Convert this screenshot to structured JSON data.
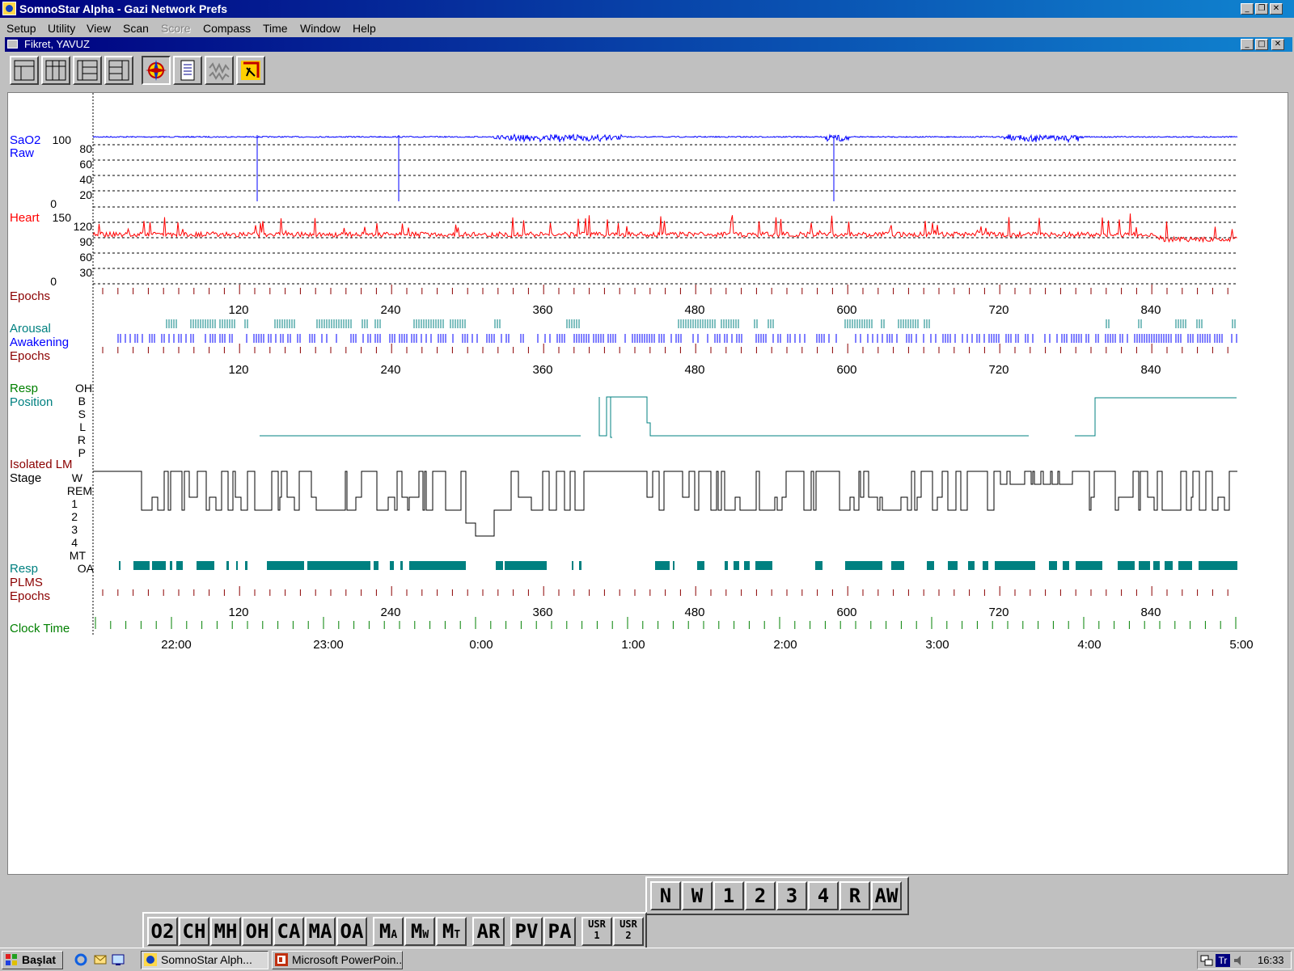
{
  "window": {
    "title": "SomnoStar Alpha - Gazi Network Prefs"
  },
  "menu": [
    "Setup",
    "Utility",
    "View",
    "Scan",
    "Score",
    "Compass",
    "Time",
    "Window",
    "Help"
  ],
  "child_window": {
    "title": "Fikret, YAVUZ"
  },
  "channels": {
    "sao2": {
      "label1": "SaO2",
      "label2": "Raw",
      "axis": [
        "100",
        "80",
        "60",
        "40",
        "20",
        "0"
      ]
    },
    "heart": {
      "label": "Heart",
      "axis": [
        "150",
        "120",
        "90",
        "60",
        "30",
        "0"
      ]
    },
    "epochs_label": "Epochs",
    "arousal": "Arousal",
    "awakening": "Awakening",
    "resp_position": {
      "label1": "Resp",
      "label2": "Position",
      "axis": [
        "OH",
        "B",
        "S",
        "L",
        "R",
        "P"
      ]
    },
    "isolated_lm": "Isolated LM",
    "stage": {
      "label": "Stage",
      "axis": [
        "W",
        "REM",
        "1",
        "2",
        "3",
        "4",
        "MT"
      ]
    },
    "resp2": {
      "label": "Resp",
      "axis": "OA"
    },
    "plms": "PLMS",
    "clock": "Clock Time"
  },
  "epoch_ticks": [
    "120",
    "240",
    "360",
    "480",
    "600",
    "720",
    "840"
  ],
  "clock_ticks": [
    "22:00",
    "23:00",
    "0:00",
    "1:00",
    "2:00",
    "3:00",
    "4:00",
    "5:00"
  ],
  "stage_buttons": [
    "N",
    "W",
    "1",
    "2",
    "3",
    "4",
    "R",
    "AW"
  ],
  "event_buttons": [
    {
      "a": "O2"
    },
    {
      "a": "CH"
    },
    {
      "a": "MH"
    },
    {
      "a": "OH"
    },
    {
      "a": "CA"
    },
    {
      "a": "MA"
    },
    {
      "a": "OA"
    },
    {
      "a": "M",
      "sub": "A"
    },
    {
      "a": "M",
      "sub": "W"
    },
    {
      "a": "M",
      "sub": "T"
    },
    {
      "a": "AR"
    },
    {
      "a": "PV"
    },
    {
      "a": "PA"
    },
    {
      "a": "USR",
      "sub": "1"
    },
    {
      "a": "USR",
      "sub": "2"
    }
  ],
  "taskbar": {
    "start": "Başlat",
    "tasks": [
      "SomnoStar Alph...",
      "Microsoft PowerPoin..."
    ],
    "tray_lang": "Tr",
    "clock": "16:33"
  },
  "colors": {
    "sao2": "#0000ff",
    "heart": "#ff0000",
    "epochs": "#8b0000",
    "teal": "#008080",
    "clock": "#008000"
  }
}
